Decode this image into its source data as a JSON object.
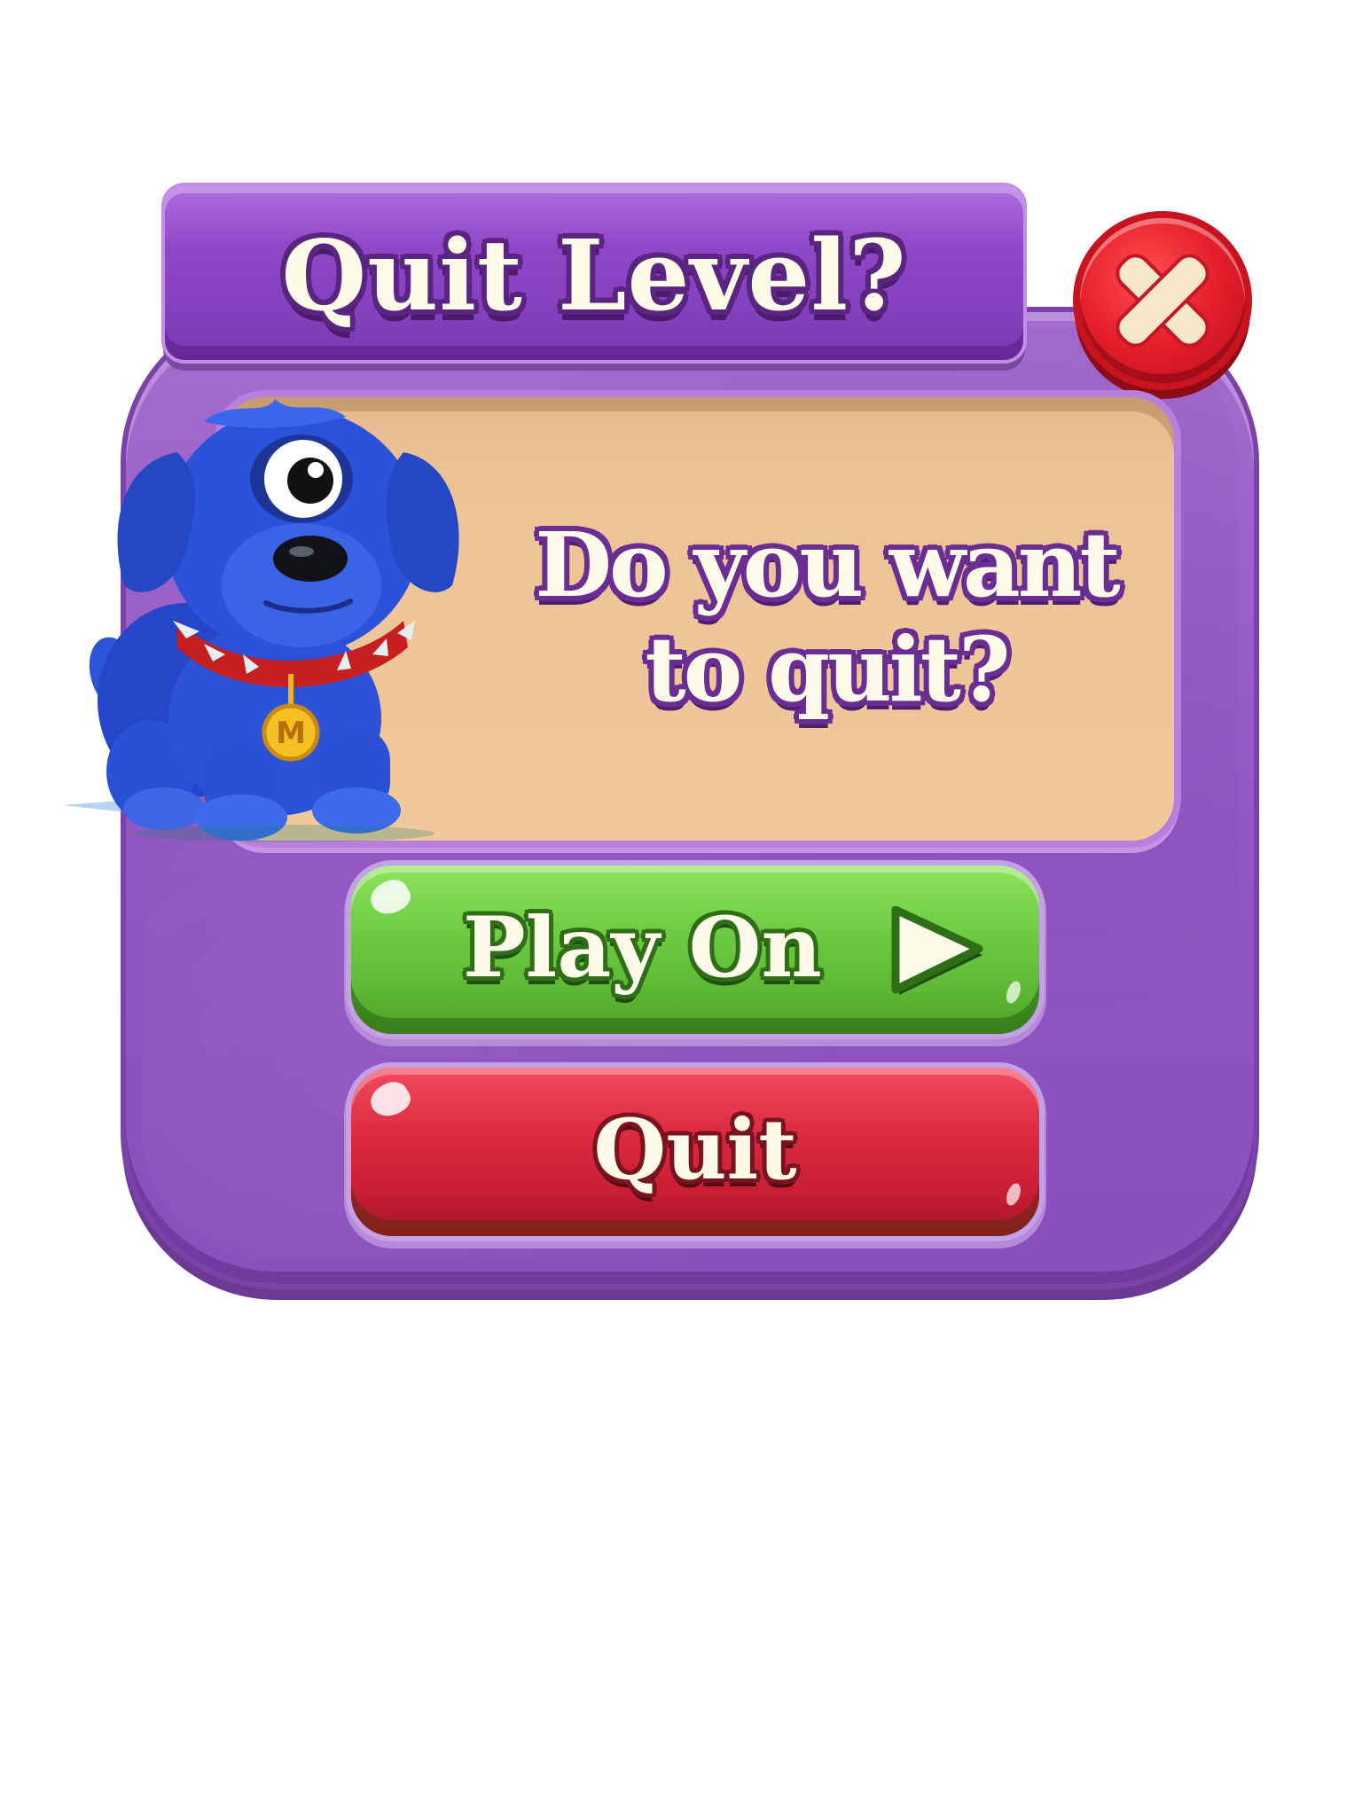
{
  "dialog": {
    "title": "Quit Level?",
    "message_line1": "Do you want",
    "message_line2": "to quit?",
    "close_icon": "close-icon",
    "mascot": "blue-one-eyed-dog",
    "mascot_medal_letter": "M"
  },
  "buttons": {
    "play_on_label": "Play On",
    "play_on_icon": "play-triangle-icon",
    "quit_label": "Quit"
  },
  "colors": {
    "panel": "#9a5cc6",
    "title_banner": "#8a43c2",
    "message_box": "#eec399",
    "play_button": "#6cc741",
    "quit_button": "#d8263c",
    "close_button": "#e41e2a",
    "text_fill": "#fffbea",
    "text_outline": "#6a2d92"
  }
}
